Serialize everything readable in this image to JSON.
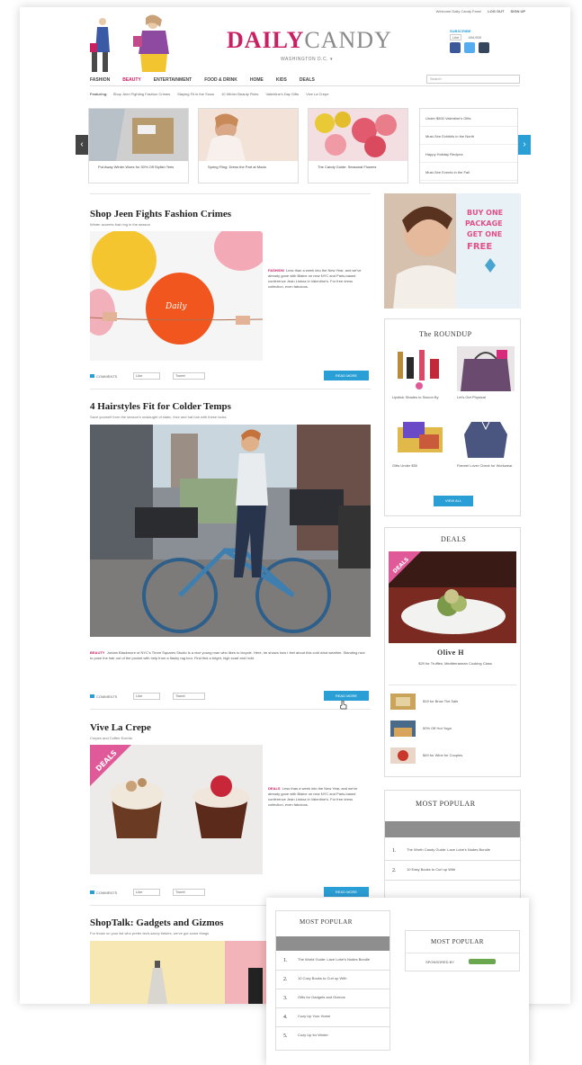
{
  "topbar": {
    "text": "Welcome Daily Candy Fans!",
    "login": "LOG OUT",
    "signup": "SIGN UP"
  },
  "logo": {
    "daily": "DAILY",
    "candy": "CANDY"
  },
  "location": "WASHINGTON D.C.",
  "social": {
    "subscribe": "SUBSCRIBE",
    "like": "Like",
    "count": "404,900"
  },
  "colors": {
    "brand": "#c91f63",
    "accent": "#2a9fd6",
    "facebook": "#3b5998",
    "twitter": "#55acee",
    "tumblr": "#36465d"
  },
  "nav": {
    "items": [
      "FASHION",
      "BEAUTY",
      "ENTERTAINMENT",
      "FOOD & DRINK",
      "HOME",
      "KIDS",
      "DEALS"
    ],
    "active": "BEAUTY",
    "search_placeholder": "Search"
  },
  "featuring": {
    "label": "Featuring:",
    "items": [
      "Shop Jeen Fighting Fashion Crimes",
      "Staying Fit in the Snow",
      "10 Winter Beauty Picks",
      "Valentine's Day Gifts",
      "Vive La Crepe"
    ]
  },
  "carousel": {
    "cards": [
      {
        "caption": "Put Away Winter Woes for 30% Off Stylish Tees"
      },
      {
        "caption": "Spring Fling: Dress the Part at Moda"
      },
      {
        "caption": "The Candy Guide: Seasonal Flowers"
      }
    ],
    "list": [
      "Under $500 Valentine's Gifts",
      "Must-See Exhibits in the North",
      "Happy Holiday Recipes",
      "Must-See Events in the Fall"
    ]
  },
  "articles": [
    {
      "title": "Shop Jeen Fights Fashion Crimes",
      "subtitle": "Winter accents that ring in the season",
      "category": "FASHION",
      "body": "Less than a week into the New Year, and we've already gone with Blaine on new NYC and Paris-based conference Jean Lisboa in Valentine's. For free dress collection, even fabulous.",
      "comments": "COMMENTS",
      "like": "Like",
      "tweet": "Tweet",
      "read_more": "READ MORE"
    },
    {
      "title": "4 Hairstyles Fit for Colder Temps",
      "subtitle": "Save yourself from the season's onslaught of static, frizz and hat hair with these looks",
      "category": "BEAUTY",
      "body": "Jordan Blackmore of NYC's Three Squares Studio is a nice young man who likes to bicycle. Here, he shows how I feel about this cold wind weather. Standing nice to pose the hair out of the pocket with help from a flashy rag tour. First find a bright, high scarf and hold.",
      "comments": "COMMENTS",
      "like": "Like",
      "tweet": "Tweet",
      "read_more": "READ MORE"
    },
    {
      "title": "Vive La Crepe",
      "subtitle": "Crepes and Coffee Events",
      "category": "DEALS",
      "body": "Less than a week into the New Year, and we've already gone with Blaine on new NYC and Paris-based conference Jean Lisboa in Valentine's. For free dress collection, even fabulous.",
      "comments": "COMMENTS",
      "like": "Like",
      "tweet": "Tweet",
      "read_more": "READ MORE",
      "badge": "DEALS"
    },
    {
      "title": "ShopTalk: Gadgets and Gizmos",
      "subtitle": "For those on your list who prefer tech-savvy tinkers, we've got some things"
    }
  ],
  "ad": {
    "line1": "BUY ONE",
    "line2": "PACKAGE",
    "line3": "GET ONE",
    "line4": "FREE"
  },
  "roundup": {
    "title": "The ROUNDUP",
    "items": [
      {
        "label": "Lipstick Shades to Swoon By"
      },
      {
        "label": "Let's Get Physical"
      },
      {
        "label": "Gifts Under $50"
      },
      {
        "label": "Flannel Lover Check for Workwear"
      }
    ],
    "button": "VIEW ALL"
  },
  "deals": {
    "title": "DEALS",
    "badge": "DEALS",
    "name": "Olive H",
    "desc": "$29 for Truffles, Mediterranean Cooking Class",
    "items": [
      "$19 for Brow Tint Sale",
      "50% Off Hot Yoga",
      "$49 for Wine for Couples"
    ]
  },
  "most_popular": {
    "title": "MOST POPULAR",
    "items": [
      {
        "n": "1.",
        "t": "The Worth Candy Guide: Lace Lobe's Nudes Bundle"
      },
      {
        "n": "2.",
        "t": "10 Easy Books to Curl up With"
      }
    ]
  },
  "overlay": {
    "popular": {
      "title": "MOST POPULAR",
      "items": [
        {
          "n": "1.",
          "t": "The World Guide: Lace Lobe's Nudes Bundle"
        },
        {
          "n": "2.",
          "t": "10 Cozy Books to Curl up With"
        },
        {
          "n": "3.",
          "t": "Gifts for Gadgets and Gizmos"
        },
        {
          "n": "4.",
          "t": "Cozy Up Your Home"
        },
        {
          "n": "5.",
          "t": "Cozy Up for Winter"
        }
      ]
    },
    "sponsored": {
      "title": "MOST POPULAR",
      "label": "SPONSORED BY"
    }
  }
}
